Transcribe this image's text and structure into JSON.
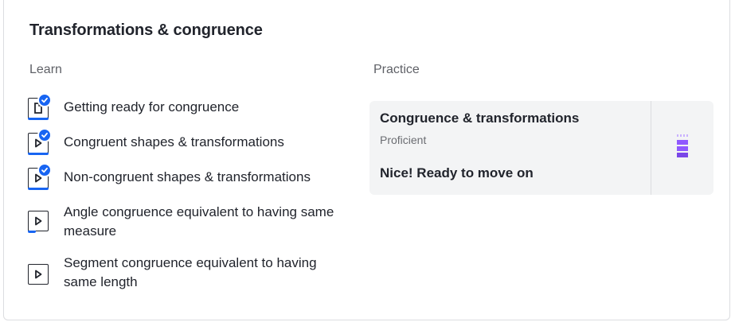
{
  "unit": {
    "title": "Transformations & congruence"
  },
  "learn": {
    "label": "Learn",
    "lessons": [
      {
        "title": "Getting ready for congruence",
        "type": "article-icon",
        "completed": true
      },
      {
        "title": "Congruent shapes & transformations",
        "type": "video-icon",
        "completed": true
      },
      {
        "title": "Non-congruent shapes & transformations",
        "type": "video-icon",
        "completed": true
      },
      {
        "title": "Angle congruence equivalent to having same measure",
        "type": "video-icon",
        "completed": false
      },
      {
        "title": "Segment congruence equivalent to having same length",
        "type": "video-icon",
        "completed": false
      }
    ]
  },
  "practice": {
    "label": "Practice",
    "exercise": {
      "title": "Congruence & transformations",
      "level": "Proficient",
      "status": "Nice! Ready to move on",
      "mastery_icon": "proficient-mastery-icon"
    }
  },
  "colors": {
    "accent": "#1865f2",
    "mastery_purple": "#9059ff",
    "card_bg": "#f3f4f5"
  }
}
